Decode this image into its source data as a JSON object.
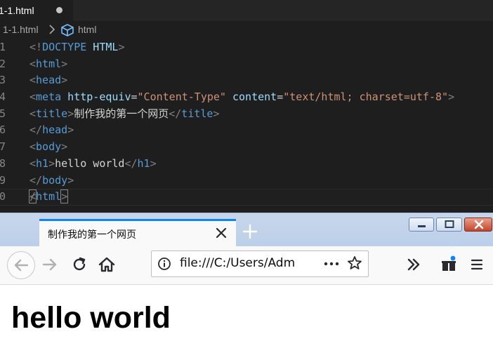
{
  "editor": {
    "tab": {
      "title": "1-1.html"
    },
    "breadcrumb": {
      "file": "1-1.html",
      "chevron": "›",
      "symbol": "html"
    },
    "lines": [
      {
        "num": "1"
      },
      {
        "num": "2"
      },
      {
        "num": "3"
      },
      {
        "num": "4"
      },
      {
        "num": "5"
      },
      {
        "num": "6"
      },
      {
        "num": "7"
      },
      {
        "num": "8"
      },
      {
        "num": "9"
      },
      {
        "num": "0"
      }
    ],
    "tokens": {
      "lt": "<",
      "gt": ">",
      "lt_slash": "</",
      "doctype_open": "<!",
      "doctype_kw": "DOCTYPE",
      "doctype_val": " HTML",
      "tag_html": "html",
      "tag_head": "head",
      "tag_meta": "meta",
      "tag_title": "title",
      "tag_body": "body",
      "tag_h1": "h1",
      "attr_http_equiv": " http-equiv",
      "eq": "=",
      "val_content_type": "\"Content-Type\"",
      "attr_content": " content",
      "val_charset": "\"text/html; charset=utf-8\"",
      "title_text": "制作我的第一个网页",
      "h1_text": "hello world"
    }
  },
  "browser": {
    "tab": {
      "title": "制作我的第一个网页"
    },
    "url": "file:///C:/Users/Adm",
    "page": {
      "heading": "hello world"
    },
    "colors": {
      "accent": "#0a84ff",
      "notification_dot": "#0a84ff",
      "close_button": "#c3452b"
    },
    "icons": [
      "back-arrow-icon",
      "forward-arrow-icon",
      "reload-icon",
      "home-icon",
      "info-icon",
      "more-dots-icon",
      "bookmark-star-icon",
      "overflow-chevrons-icon",
      "extensions-icon",
      "menu-icon",
      "close-tab-icon",
      "new-tab-plus-icon"
    ]
  }
}
